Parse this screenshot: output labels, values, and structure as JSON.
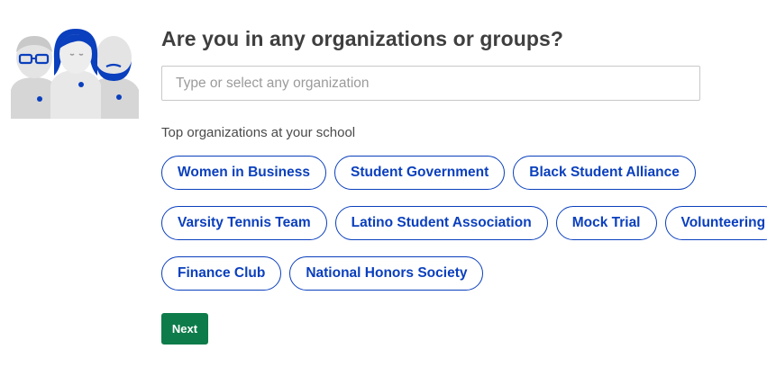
{
  "page": {
    "title": "Are you in any organizations or groups?",
    "subtitle": "Top organizations at your school"
  },
  "search": {
    "placeholder": "Type or select any organization",
    "value": ""
  },
  "organizations": [
    "Women in Business",
    "Student Government",
    "Black Student Alliance",
    "Varsity Tennis Team",
    "Latino Student Association",
    "Mock Trial",
    "Volunteering",
    "Finance Club",
    "National Honors Society"
  ],
  "next_button": {
    "label": "Next"
  },
  "colors": {
    "chip_accent": "#0a3fbd",
    "next_button_bg": "#0e7c4a",
    "title_text": "#3f3f3f",
    "illustration_gray": "#d6d6d6",
    "illustration_blue": "#0a3fbd"
  },
  "illustration": {
    "name": "students-group-illustration"
  }
}
